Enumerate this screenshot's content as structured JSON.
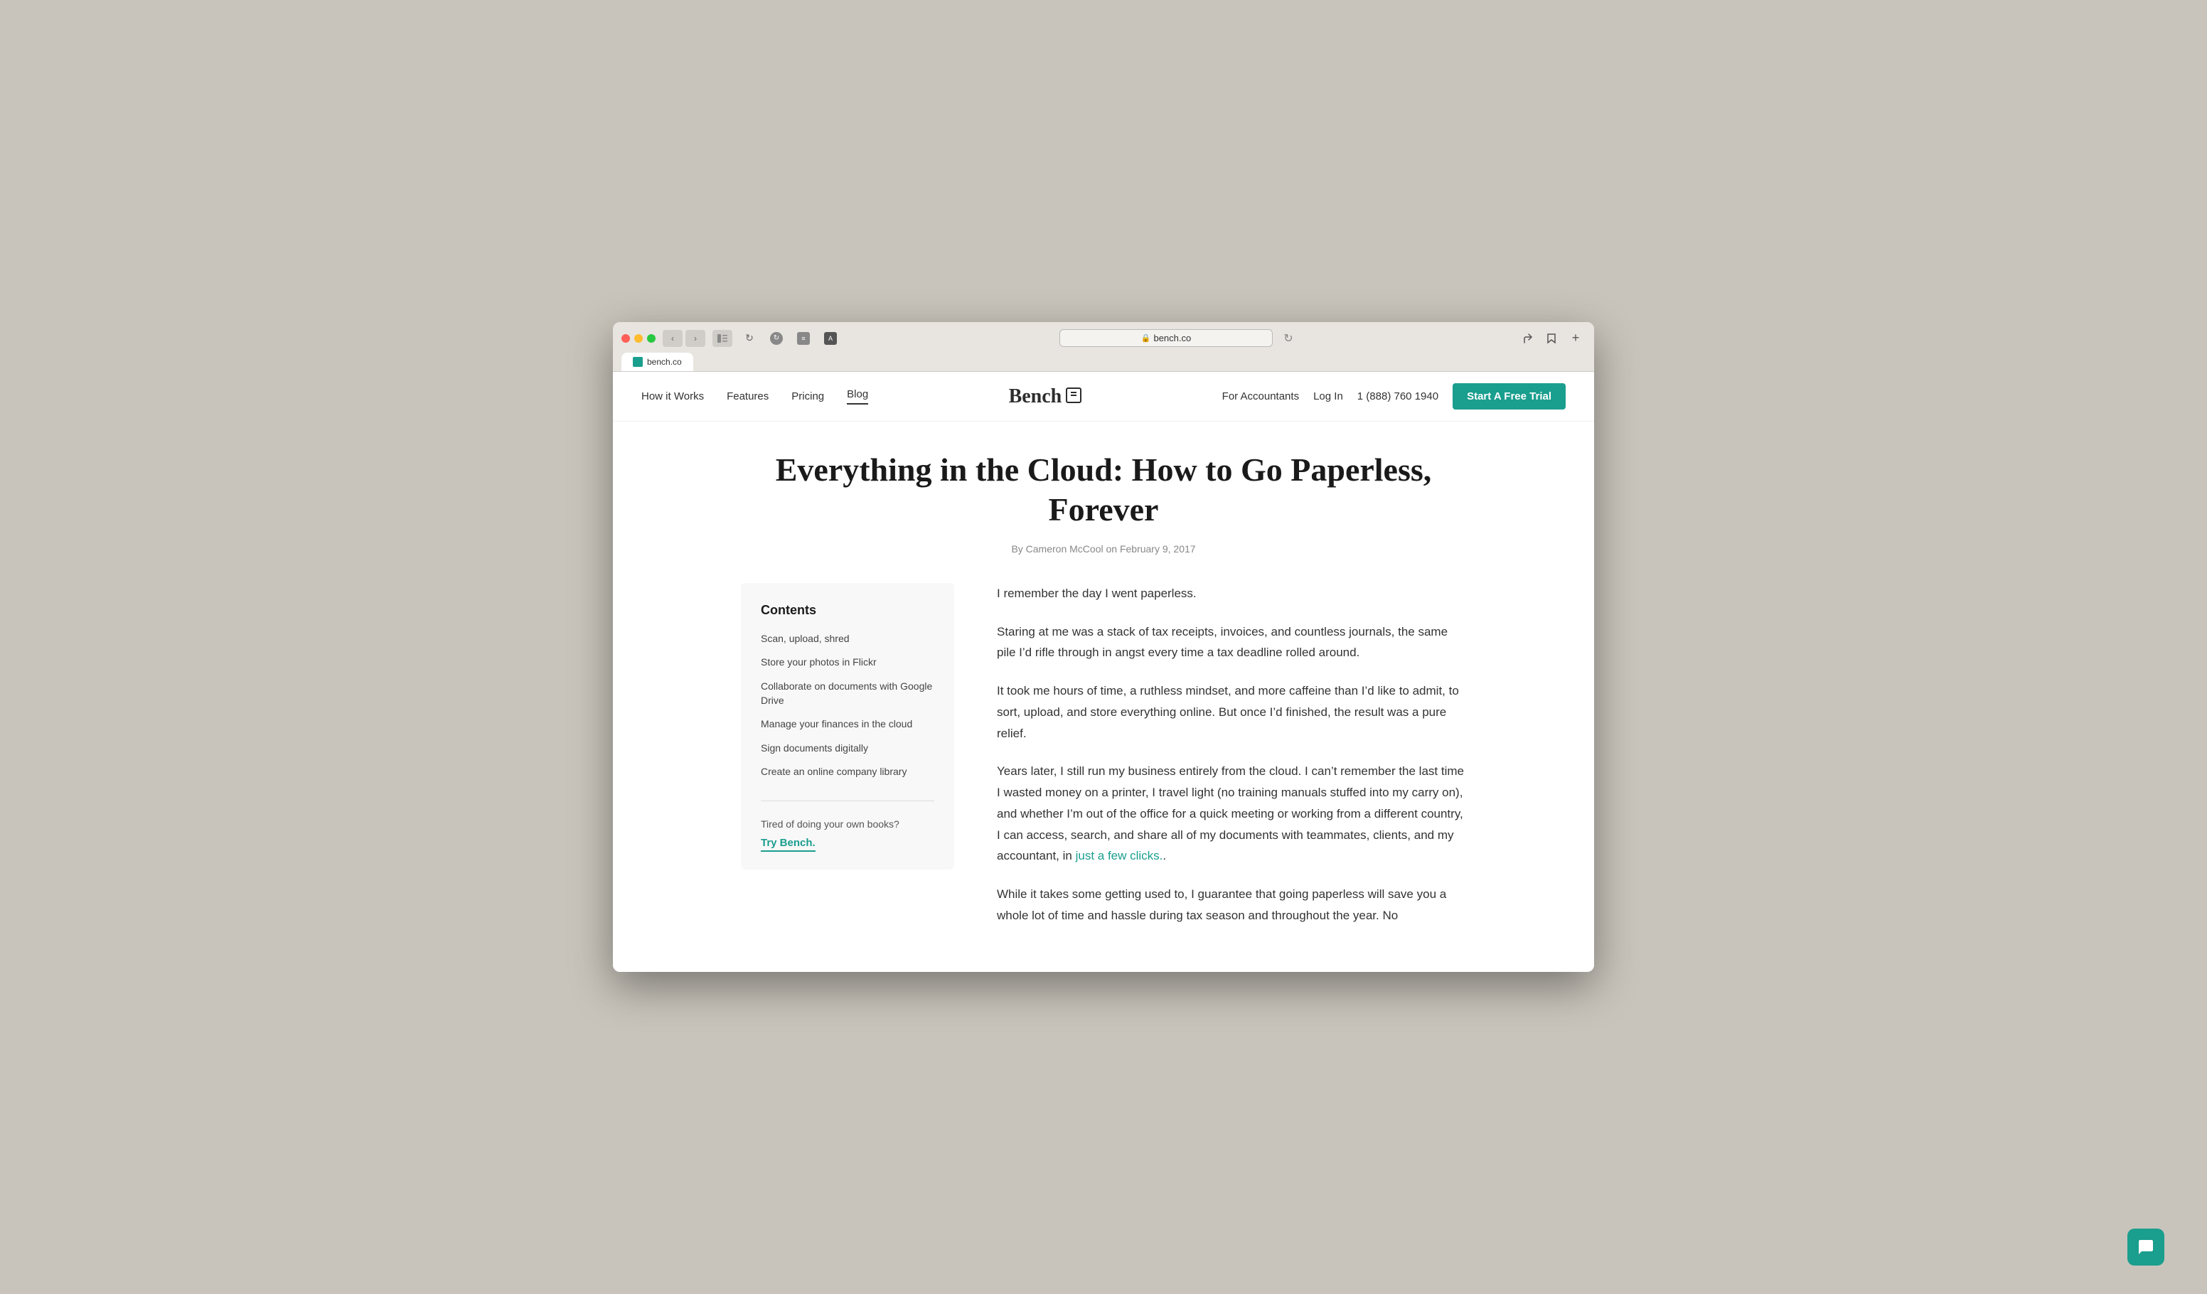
{
  "browser": {
    "url": "bench.co",
    "tab_title": "bench.co"
  },
  "nav": {
    "links": [
      {
        "label": "How it Works",
        "active": false
      },
      {
        "label": "Features",
        "active": false
      },
      {
        "label": "Pricing",
        "active": false
      },
      {
        "label": "Blog",
        "active": true
      }
    ],
    "logo": "Bench",
    "right_links": [
      {
        "label": "For Accountants"
      },
      {
        "label": "Log In"
      },
      {
        "label": "1 (888) 760 1940"
      }
    ],
    "cta_button": "Start A Free Trial"
  },
  "article": {
    "title": "Everything in the Cloud: How to Go Paperless, Forever",
    "meta": "By Cameron McCool on February 9, 2017",
    "toc": {
      "heading": "Contents",
      "items": [
        {
          "label": "Scan, upload, shred"
        },
        {
          "label": "Store your photos in Flickr"
        },
        {
          "label": "Collaborate on documents with Google Drive"
        },
        {
          "label": "Manage your finances in the cloud"
        },
        {
          "label": "Sign documents digitally"
        },
        {
          "label": "Create an online company library"
        }
      ],
      "cta_text": "Tired of doing your own books?",
      "cta_link": "Try Bench."
    },
    "paragraphs": [
      "I remember the day I went paperless.",
      "Staring at me was a stack of tax receipts, invoices, and countless journals, the same pile I’d rifle through in angst every time a tax deadline rolled around.",
      "It took me hours of time, a ruthless mindset, and more caffeine than I’d like to admit, to sort, upload, and store everything online. But once I’d finished, the result was a pure relief.",
      "Years later, I still run my business entirely from the cloud. I can’t remember the last time I wasted money on a printer, I travel light (no training manuals stuffed into my carry on), and whether I’m out of the office for a quick meeting or working from a different country, I can access, search, and share all of my documents with teammates, clients, and my accountant, in",
      "just a few clicks.",
      "While it takes some getting used to, I guarantee that going paperless will save you a whole lot of time and hassle during tax season and throughout the year. No"
    ]
  },
  "chat": {
    "icon": "💬"
  }
}
